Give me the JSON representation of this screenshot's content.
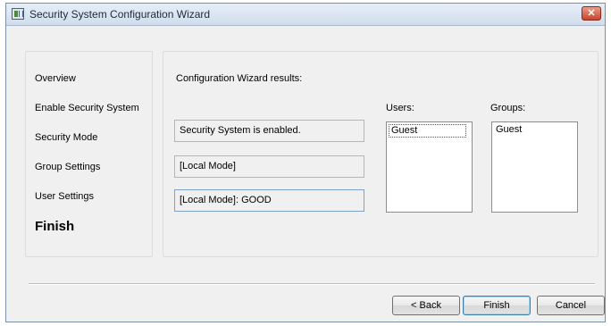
{
  "window": {
    "title": "Security System Configuration Wizard",
    "close_symbol": "✕"
  },
  "nav": {
    "items": [
      {
        "label": "Overview",
        "active": false
      },
      {
        "label": "Enable Security System",
        "active": false
      },
      {
        "label": "Security Mode",
        "active": false
      },
      {
        "label": "Group Settings",
        "active": false
      },
      {
        "label": "User Settings",
        "active": false
      },
      {
        "label": "Finish",
        "active": true
      }
    ]
  },
  "results": {
    "title": "Configuration Wizard results:",
    "lines": [
      "Security System is enabled.",
      "[Local Mode]",
      "[Local Mode]: GOOD"
    ]
  },
  "users": {
    "label": "Users:",
    "items": [
      "Guest"
    ]
  },
  "groups": {
    "label": "Groups:",
    "items": [
      "Guest"
    ]
  },
  "buttons": {
    "back": "< Back",
    "finish": "Finish",
    "cancel": "Cancel"
  }
}
